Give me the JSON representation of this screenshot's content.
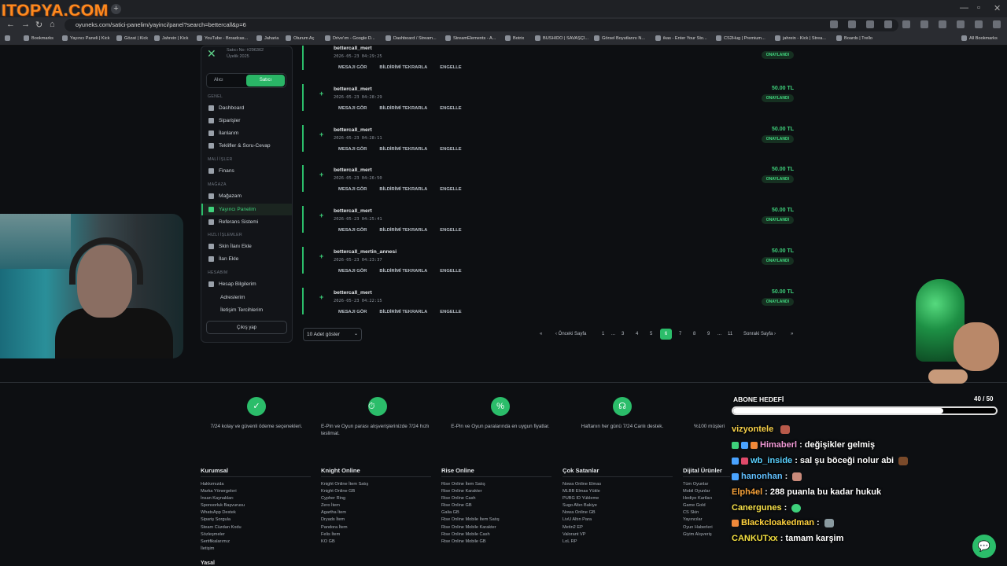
{
  "browser": {
    "watermark": "ITOPYA.COM",
    "url": "oyuneks.com/satici-panelim/yayinci/panel?search=bettercall&p=6",
    "bookmarks": [
      "Bookmarks",
      "Yayıncı Paneli | Kick",
      "Gözat | Kick",
      "Jahrein | Kick",
      "YouTube - Broadcas...",
      "Jaharia",
      "Oturum Aç",
      "Drive'ım - Google D...",
      "Dashboard / Stream...",
      "StreamElements - A...",
      "Botrix",
      "BUSHIDO | SAVAŞÇI...",
      "Görsel Boyutlarını N...",
      "ikas - Enter Your Sto...",
      "CS2Hug | Premium...",
      "jahrein - Kick | Strea...",
      "Boards | Trello",
      "All Bookmarks"
    ]
  },
  "sidebar": {
    "user_meta_1": "Satıcı No: #296362",
    "user_meta_2": "Üyelik 2025",
    "toggle": {
      "buyer": "Alıcı",
      "seller": "Satıcı"
    },
    "sections": {
      "genel": "GENEL",
      "mali": "MALİ İŞLER",
      "magaza": "MAĞAZA",
      "hizli": "HIZLI İŞLEMLER",
      "hesabim": "HESABIM"
    },
    "items": {
      "dashboard": "Dashboard",
      "siparisler": "Siparişler",
      "ilanlarim": "İlanlarım",
      "teklifler": "Teklifler & Soru-Cevap",
      "finans": "Finans",
      "magazam": "Mağazam",
      "yayinci": "Yayıncı Panelim",
      "referans": "Referans Sistemi",
      "skin": "Skin İlanı Ekle",
      "ilan": "İlan Ekle",
      "hesap": "Hesap Bilgilerim",
      "adresler": "Adreslerim",
      "iletisim": "İletişim Tercihlerim"
    },
    "logout": "Çıkış yap"
  },
  "donations": {
    "actions": {
      "view": "MESAJI GÖR",
      "replay": "BİLDİRİMİ TEKRARLA",
      "block": "ENGELLE"
    },
    "status": "ONAYLANDI",
    "rows": [
      {
        "user": "bettercall_mert",
        "date": "2026-05-23 04:29:25",
        "amount": "50.00 TL"
      },
      {
        "user": "bettercall_mert",
        "date": "2026-05-23 04:28:29",
        "amount": "50.00 TL"
      },
      {
        "user": "bettercall_mert",
        "date": "2026-05-23 04:28:11",
        "amount": "50.00 TL"
      },
      {
        "user": "bettercall_mert",
        "date": "2026-05-23 04:26:50",
        "amount": "50.00 TL"
      },
      {
        "user": "bettercall_mert",
        "date": "2026-05-23 04:25:41",
        "amount": "50.00 TL"
      },
      {
        "user": "bettercall_mertin_annesi",
        "date": "2026-05-23 04:23:37",
        "amount": "50.00 TL"
      },
      {
        "user": "bettercall_mert",
        "date": "2026-05-23 04:22:15",
        "amount": "50.00 TL"
      }
    ]
  },
  "pagination": {
    "page_size": "10 Adet göster",
    "first": "«",
    "prev": "‹ Önceki Sayfa",
    "next": "Sonraki Sayfa ›",
    "last": "»",
    "pages": [
      "1",
      "...",
      "3",
      "4",
      "5",
      "6",
      "7",
      "8",
      "9",
      "...",
      "11"
    ],
    "current": "6"
  },
  "features": [
    "7/24 kolay ve güvenli ödeme seçenekleri.",
    "E-Pin ve Oyun parası alışverişlerinizde 7/24 hızlı teslimat.",
    "E-Pin ve Oyun paralarında en uygun fiyatlar.",
    "Haftanın her günü 7/24 Canlı destek.",
    "%100 müşteri"
  ],
  "footer": {
    "columns": [
      {
        "title": "Kurumsal",
        "links": [
          "Hakkımızda",
          "Marka Yönergeleri",
          "İnsan Kaynakları",
          "Sponsorluk Başvurusu",
          "WhatsApp Destek",
          "Sipariş Sorgula",
          "Steam Cüzdan Kodu",
          "Sözleşmeler",
          "Sertifikalarımız",
          "İletişim"
        ]
      },
      {
        "title": "Knight Online",
        "links": [
          "Knight Online İtem Satış",
          "Knight Online GB",
          "Cypher Ring",
          "Zero İtem",
          "Agartha İtem",
          "Dryads İtem",
          "Pandora İtem",
          "Felis İtem",
          "KO GB"
        ]
      },
      {
        "title": "Rise Online",
        "links": [
          "Rise Online İtem Satış",
          "Rise Online Karakter",
          "Rise Online Cash",
          "Rise Online GB",
          "Galia GB",
          "Rise Online Mobile İtem Satış",
          "Rise Online Mobile Karakter",
          "Rise Online Mobile Cash",
          "Rise Online Mobile GB"
        ]
      },
      {
        "title": "Çok Satanlar",
        "links": [
          "Nowa Online Elmas",
          "MLBB Elmas Yükle",
          "PUBG ID Yükleme",
          "Sugo Altın Bakiye",
          "Nowa Online GB",
          "LivU Altın Para",
          "Metin2 EP",
          "Valorant VP",
          "LoL RP"
        ]
      },
      {
        "title": "Dijital Ürünler",
        "links": [
          "Tüm Oyunlar",
          "Mobil Oyunlar",
          "Hediye Kartları",
          "Game Gold",
          "CS Skin",
          "Yayıncılar",
          "Oyun Haberleri",
          "Giyim Alışveriş"
        ]
      }
    ],
    "yasal": "Yasal"
  },
  "overlay": {
    "goal_title": "ABONE HEDEFİ",
    "goal_count": "40 / 50",
    "goal_progress": 0.8,
    "chat": [
      {
        "user": "vizyontele",
        "msg": "",
        "color": "#f7d14a"
      },
      {
        "user": "Himaberl",
        "msg": ": değişikler gelmiş",
        "color": "#f29ad8"
      },
      {
        "user": "wb_inside",
        "msg": ": sal şu böceği nolur abi",
        "color": "#5ad1ff"
      },
      {
        "user": "hanonhan",
        "msg": ":",
        "color": "#61c0ff"
      },
      {
        "user": "Elph4el",
        "msg": ": 288 puanla bu kadar hukuk",
        "color": "#f7a23a"
      },
      {
        "user": "Canergunes",
        "msg": ":",
        "color": "#f7e14a"
      },
      {
        "user": "Blackcloakedman",
        "msg": ":",
        "color": "#ffd23f"
      },
      {
        "user": "CANKUTxx",
        "msg": ": tamam karşim",
        "color": "#f5e142"
      }
    ]
  }
}
